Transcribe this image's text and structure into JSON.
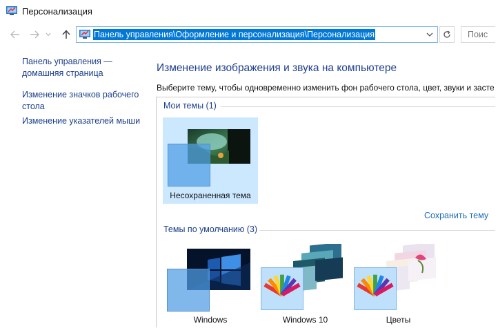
{
  "window": {
    "title": "Персонализация"
  },
  "nav": {
    "back_icon": "arrow-left-icon",
    "forward_icon": "arrow-right-icon",
    "recent_icon": "chevron-down-icon",
    "up_icon": "arrow-up-icon"
  },
  "address": {
    "path": "Панель управления\\Оформление и персонализация\\Персонализация",
    "search_placeholder": "Поис"
  },
  "sidebar": {
    "items": [
      {
        "label": "Панель управления —\nдомашняя страница"
      },
      {
        "label": "Изменение значков рабочего\nстола"
      },
      {
        "label": "Изменение указателей мыши"
      }
    ]
  },
  "main": {
    "title": "Изменение изображения и звука на компьютере",
    "description": "Выберите тему, чтобы одновременно изменить фон рабочего стола, цвет, звуки и засте"
  },
  "my_themes": {
    "label": "Мои темы (1)",
    "items": [
      {
        "name": "Несохраненная тема",
        "selected": true
      }
    ],
    "save_link": "Сохранить тему"
  },
  "default_themes": {
    "label": "Темы по умолчанию (3)",
    "items": [
      {
        "name": "Windows"
      },
      {
        "name": "Windows 10"
      },
      {
        "name": "Цветы"
      }
    ]
  },
  "colors": {
    "accent": "#0078d7",
    "link": "#1a3e8a",
    "selection": "#cce8ff"
  }
}
